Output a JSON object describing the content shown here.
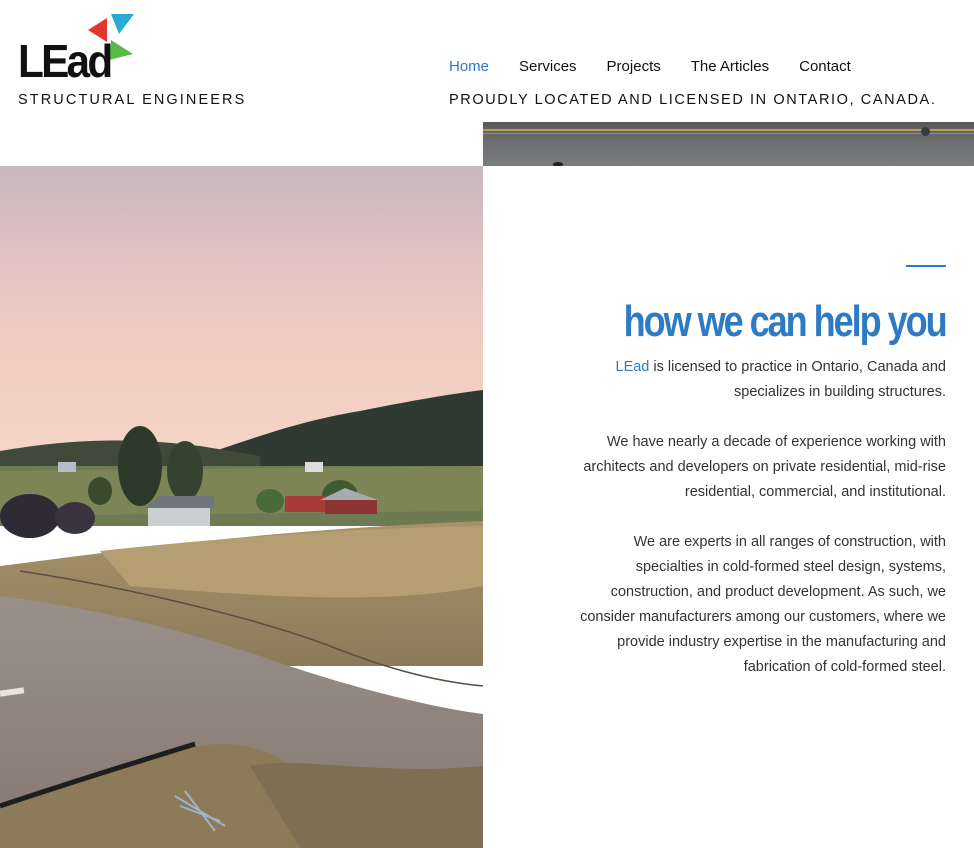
{
  "header": {
    "logo_text": "LEad",
    "logo_tagline": "STRUCTURAL ENGINEERS",
    "located_text": "PROUDLY LOCATED AND LICENSED IN ONTARIO, CANADA."
  },
  "nav": {
    "items": [
      {
        "label": "Home",
        "active": true
      },
      {
        "label": "Services",
        "active": false
      },
      {
        "label": "Projects",
        "active": false
      },
      {
        "label": "The Articles",
        "active": false
      },
      {
        "label": "Contact",
        "active": false
      }
    ]
  },
  "main": {
    "heading": "how we can help you",
    "para1_brand": "LEad",
    "para1_rest": " is licensed to practice in Ontario, Canada and specializes in building structures.",
    "para2": "We have nearly a decade of experience working with architects and developers on private residential, mid-rise residential, commercial, and institutional.",
    "para3": "We are experts in all ranges of construction, with specialties in cold-formed steel design, systems, construction, and product development. As such, we consider manufacturers among our customers, where we provide industry expertise in the manufacturing and fabrication of cold-formed steel."
  },
  "colors": {
    "accent": "#2e7bc4",
    "logo_red": "#e0382c",
    "logo_cyan": "#29a9d6",
    "logo_green": "#5ab847"
  },
  "icons": {
    "logo_mark": "three-triangles-logo-icon"
  }
}
